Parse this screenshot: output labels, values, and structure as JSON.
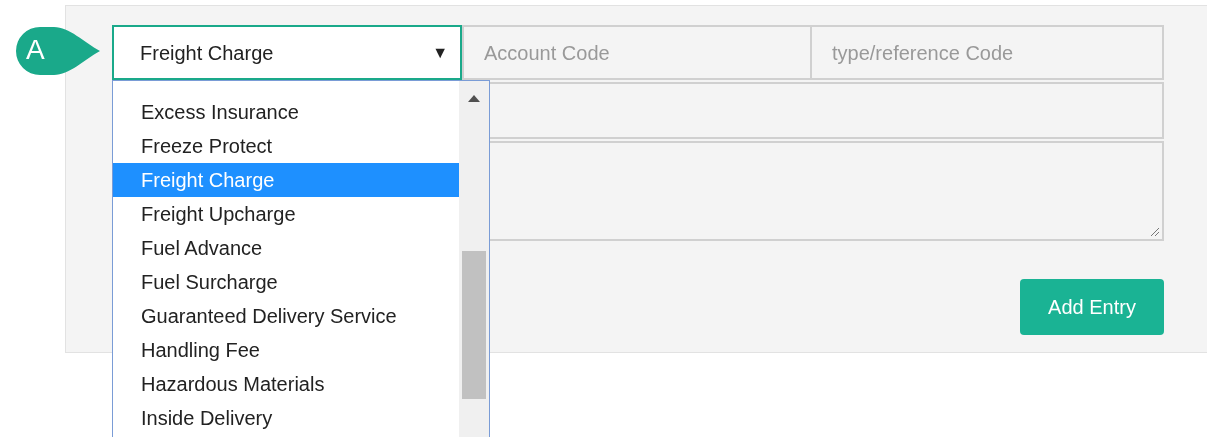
{
  "badge": {
    "label": "A"
  },
  "charge_select": {
    "value": "Freight Charge",
    "expanded": true,
    "caret": "▼"
  },
  "account_code": {
    "placeholder": "Account Code"
  },
  "reference_code": {
    "placeholder": "type/reference Code"
  },
  "options": [
    {
      "label": "Excess Insurance",
      "selected": false
    },
    {
      "label": "Freeze Protect",
      "selected": false
    },
    {
      "label": "Freight Charge",
      "selected": true
    },
    {
      "label": "Freight Upcharge",
      "selected": false
    },
    {
      "label": "Fuel Advance",
      "selected": false
    },
    {
      "label": "Fuel Surcharge",
      "selected": false
    },
    {
      "label": "Guaranteed Delivery Service",
      "selected": false
    },
    {
      "label": "Handling Fee",
      "selected": false
    },
    {
      "label": "Hazardous Materials",
      "selected": false
    },
    {
      "label": "Inside Delivery",
      "selected": false
    }
  ],
  "add_button": {
    "label": "Add Entry"
  }
}
